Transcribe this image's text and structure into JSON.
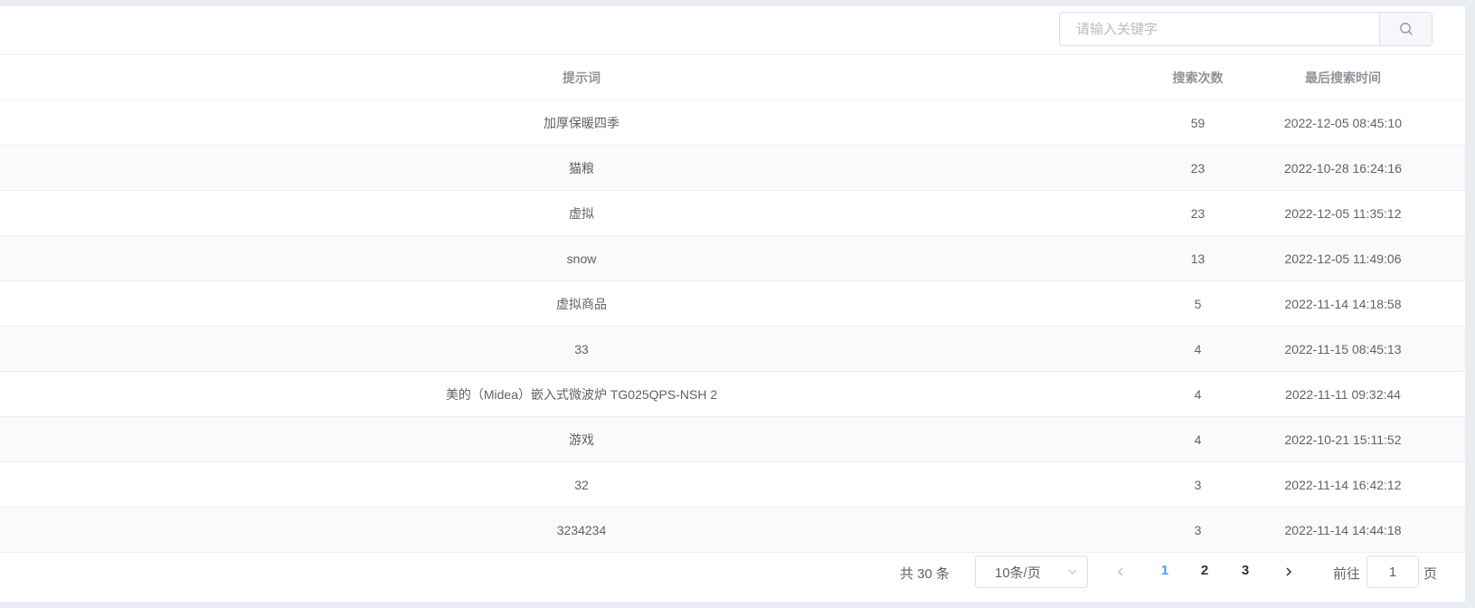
{
  "search": {
    "placeholder": "请输入关键字",
    "button_icon": "search-icon"
  },
  "table": {
    "columns": [
      "提示词",
      "搜索次数",
      "最后搜索时间"
    ],
    "rows": [
      {
        "keyword": "加厚保暖四季",
        "count": "59",
        "last_time": "2022-12-05 08:45:10"
      },
      {
        "keyword": "猫粮",
        "count": "23",
        "last_time": "2022-10-28 16:24:16"
      },
      {
        "keyword": "虚拟",
        "count": "23",
        "last_time": "2022-12-05 11:35:12"
      },
      {
        "keyword": "snow",
        "count": "13",
        "last_time": "2022-12-05 11:49:06"
      },
      {
        "keyword": "虚拟商品",
        "count": "5",
        "last_time": "2022-11-14 14:18:58"
      },
      {
        "keyword": "33",
        "count": "4",
        "last_time": "2022-11-15 08:45:13"
      },
      {
        "keyword": "美的（Midea）嵌入式微波炉 TG025QPS-NSH 2",
        "count": "4",
        "last_time": "2022-11-11 09:32:44"
      },
      {
        "keyword": "游戏",
        "count": "4",
        "last_time": "2022-10-21 15:11:52"
      },
      {
        "keyword": "32",
        "count": "3",
        "last_time": "2022-11-14 16:42:12"
      },
      {
        "keyword": "3234234",
        "count": "3",
        "last_time": "2022-11-14 14:44:18"
      }
    ]
  },
  "pagination": {
    "total_text": "共 30 条",
    "page_size": "10条/页",
    "pages": [
      "1",
      "2",
      "3"
    ],
    "current_page": "1",
    "goto_label": "前往",
    "goto_value": "1",
    "goto_suffix": "页"
  },
  "colors": {
    "accent": "#409eff",
    "stripe": "#fafafa",
    "border": "#ebeef5"
  }
}
